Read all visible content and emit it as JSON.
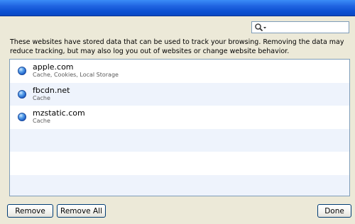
{
  "description": "These websites have stored data that can be used to track your browsing. Removing the data may reduce tracking, but may also log you out of websites or change website behavior.",
  "search": {
    "icon": "search-icon",
    "value": ""
  },
  "sites": [
    {
      "name": "apple.com",
      "detail": "Cache, Cookies, Local Storage",
      "icon": "globe-icon"
    },
    {
      "name": "fbcdn.net",
      "detail": "Cache",
      "icon": "globe-icon"
    },
    {
      "name": "mzstatic.com",
      "detail": "Cache",
      "icon": "globe-icon"
    }
  ],
  "buttons": {
    "remove": "Remove",
    "remove_all": "Remove All",
    "done": "Done"
  }
}
